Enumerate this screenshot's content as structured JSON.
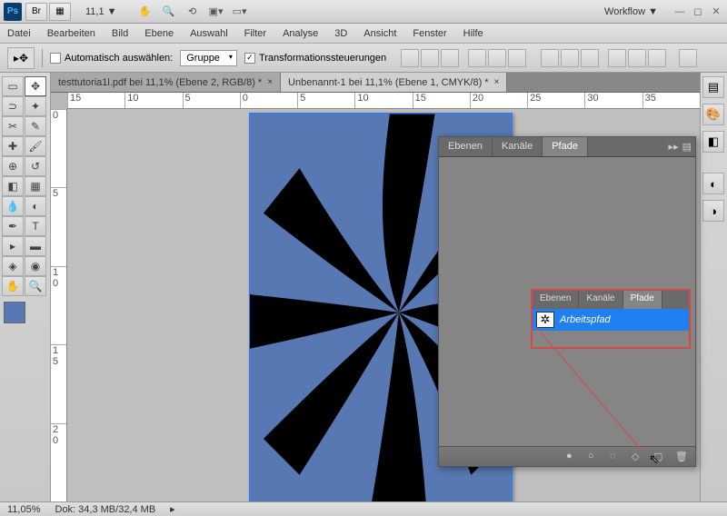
{
  "titlebar": {
    "zoom": "11,1",
    "workflow": "Workflow ▼"
  },
  "menu": [
    "Datei",
    "Bearbeiten",
    "Bild",
    "Ebene",
    "Auswahl",
    "Filter",
    "Analyse",
    "3D",
    "Ansicht",
    "Fenster",
    "Hilfe"
  ],
  "options": {
    "auto_select": "Automatisch auswählen:",
    "group": "Gruppe",
    "transform": "Transformationssteuerungen"
  },
  "tabs": [
    {
      "label": "testtutoria1l.pdf bei 11,1% (Ebene 2, RGB/8) *"
    },
    {
      "label": "Unbenannt-1 bei 11,1% (Ebene 1, CMYK/8) *"
    }
  ],
  "ruler_h": [
    "15",
    "10",
    "5",
    "0",
    "5",
    "10",
    "15",
    "20",
    "25",
    "30",
    "35"
  ],
  "ruler_v": [
    "0",
    "5",
    "1 0",
    "1 5",
    "2 0"
  ],
  "panel": {
    "tabs": [
      "Ebenen",
      "Kanäle",
      "Pfade"
    ]
  },
  "inner_panel": {
    "tabs": [
      "Ebenen",
      "Kanäle",
      "Pfade"
    ],
    "path_name": "Arbeitspfad"
  },
  "status": {
    "zoom": "11,05%",
    "doc": "Dok: 34,3 MB/32,4 MB"
  }
}
